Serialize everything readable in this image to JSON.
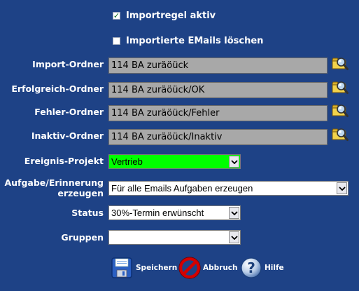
{
  "checkboxes": {
    "active": {
      "label": "Importregel aktiv",
      "checked": true
    },
    "delete": {
      "label": "Importierte EMails löschen",
      "checked": false
    }
  },
  "folders": [
    {
      "label": "Import-Ordner",
      "value": "114 BA zuräöück"
    },
    {
      "label": "Erfolgreich-Ordner",
      "value": "114 BA zuräöück/OK"
    },
    {
      "label": "Fehler-Ordner",
      "value": "114 BA zuräöück/Fehler"
    },
    {
      "label": "Inaktiv-Ordner",
      "value": "114 BA zuräöück/Inaktiv"
    }
  ],
  "project": {
    "label": "Ereignis-Projekt",
    "value": "Vertrieb",
    "color": "#00ff00"
  },
  "tasks": {
    "label_line1": "Aufgabe/Erinnerung",
    "label_line2": "erzeugen",
    "value": "Für alle Emails Aufgaben erzeugen"
  },
  "status": {
    "label": "Status",
    "value": "30%-Termin erwünscht"
  },
  "groups": {
    "label": "Gruppen",
    "value": ""
  },
  "buttons": {
    "save": "Speichern",
    "cancel": "Abbruch",
    "help": "Hilfe"
  },
  "icons": {
    "folder_browse": "folder-magnifier-icon",
    "save": "floppy-disk-icon",
    "cancel": "no-entry-icon",
    "help": "question-mark-icon"
  }
}
